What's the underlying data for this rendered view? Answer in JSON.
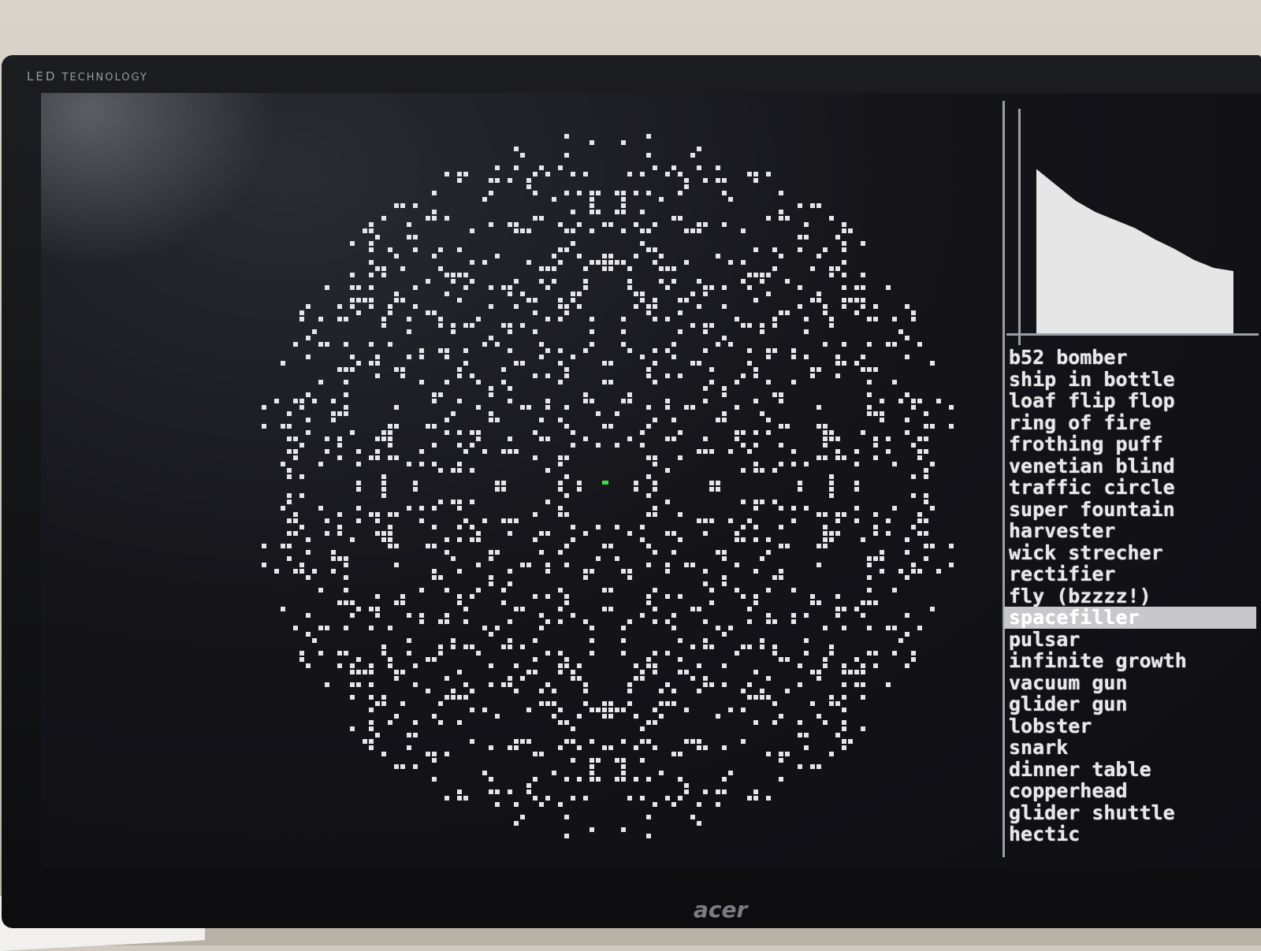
{
  "monitor": {
    "bezel_label": "LED",
    "bezel_label_small": "TECHNOLOGY",
    "brand": "acer"
  },
  "population_graph": {
    "shape": "declining",
    "fill_color": "#e6e6e6",
    "points": [
      [
        0,
        0.18
      ],
      [
        0.1,
        0.28
      ],
      [
        0.2,
        0.38
      ],
      [
        0.3,
        0.45
      ],
      [
        0.4,
        0.5
      ],
      [
        0.5,
        0.55
      ],
      [
        0.6,
        0.62
      ],
      [
        0.7,
        0.68
      ],
      [
        0.8,
        0.75
      ],
      [
        0.9,
        0.8
      ],
      [
        1.0,
        0.82
      ]
    ]
  },
  "patterns": {
    "selected_index": 12,
    "items": [
      "b52 bomber",
      "ship in bottle",
      "loaf flip flop",
      "ring of fire",
      "frothing puff",
      "venetian blind",
      "traffic circle",
      "super fountain",
      "harvester",
      "wick strecher",
      "rectifier",
      "fly (bzzzz!)",
      "spacefiller",
      "pulsar",
      "infinite growth",
      "vacuum gun",
      "glider gun",
      "lobster",
      "snark",
      "dinner table",
      "copperhead",
      "glider shuttle",
      "hectic"
    ]
  },
  "colors": {
    "screen_bg": "#121218",
    "cell": "#e6e6ea",
    "highlight_cell": "#3ddc4a",
    "selection_bg": "#c8c8cc"
  }
}
